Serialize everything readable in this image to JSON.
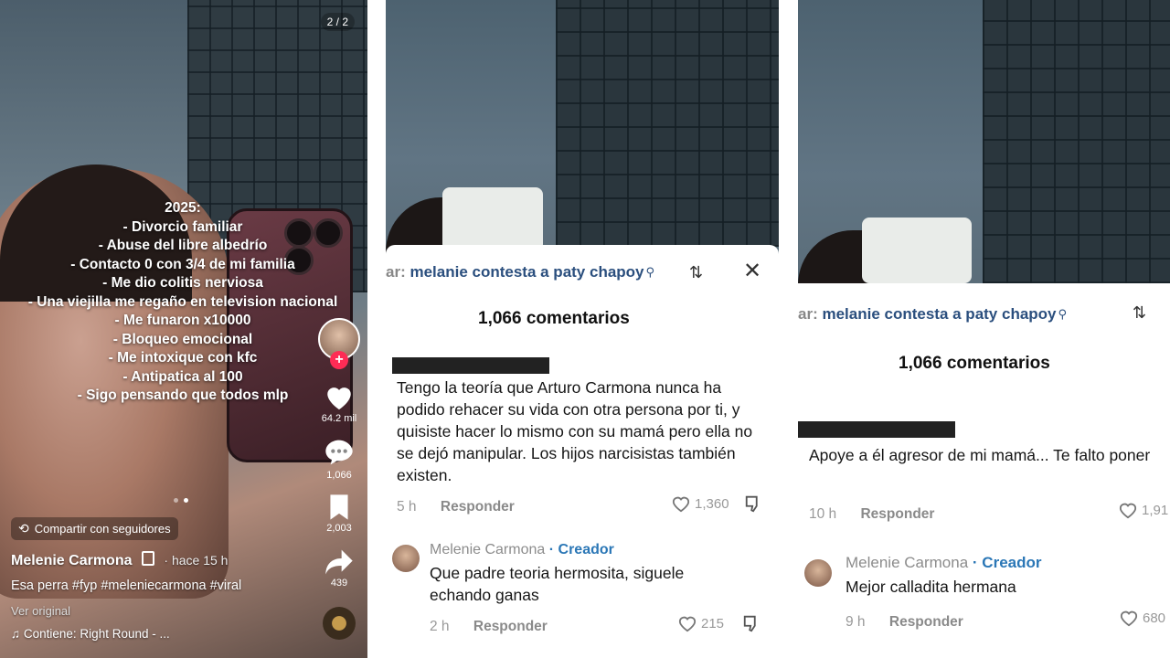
{
  "panel1": {
    "counter": "2 / 2",
    "overlay_lines": [
      "2025:",
      "- Divorcio familiar",
      "- Abuse del libre albedrío",
      "- Contacto 0 con 3/4 de mi familia",
      "- Me dio colitis nerviosa",
      "- Una viejilla me regaño en television nacional",
      "- Me funaron x10000",
      "- Bloqueo emocional",
      "- Me intoxique con kfc",
      "- Antipatica al 100",
      "- Sigo pensando que todos mlp"
    ],
    "likes": "64.2 mil",
    "comments": "1,066",
    "saves": "2,003",
    "shares": "439",
    "share_followers": "Compartir con seguidores",
    "username": "Melenie Carmona",
    "time_ago": "· hace 15 h",
    "caption": "Esa perra #fyp #meleniecarmona #viral",
    "see_original": "Ver original",
    "music": "Contiene: Right Round - ..."
  },
  "panel2": {
    "search_prefix": "ar:",
    "search_query": "melanie contesta a paty chapoy",
    "comments_count": "1,066 comentarios",
    "comment1": {
      "text": "Tengo la teoría que Arturo Carmona nunca ha podido rehacer su vida con otra persona por ti, y quisiste hacer lo mismo con su mamá pero ella no se dejó manipular. Los hijos narcisistas también existen.",
      "time": "5 h",
      "reply": "Responder",
      "likes": "1,360"
    },
    "reply1": {
      "name": "Melenie Carmona",
      "tag": "· Creador",
      "text": "Que padre teoria hermosita, siguele echando ganas",
      "time": "2 h",
      "reply": "Responder",
      "likes": "215"
    }
  },
  "panel3": {
    "search_prefix": "ar:",
    "search_query": "melanie contesta a paty chapoy",
    "comments_count": "1,066 comentarios",
    "comment1": {
      "text": "Apoye a él agresor de mi mamá... Te falto poner",
      "time": "10 h",
      "reply": "Responder",
      "likes": "1,91"
    },
    "reply1": {
      "name": "Melenie Carmona",
      "tag": "· Creador",
      "text": "Mejor calladita hermana",
      "time": "9 h",
      "reply": "Responder",
      "likes": "680"
    }
  }
}
